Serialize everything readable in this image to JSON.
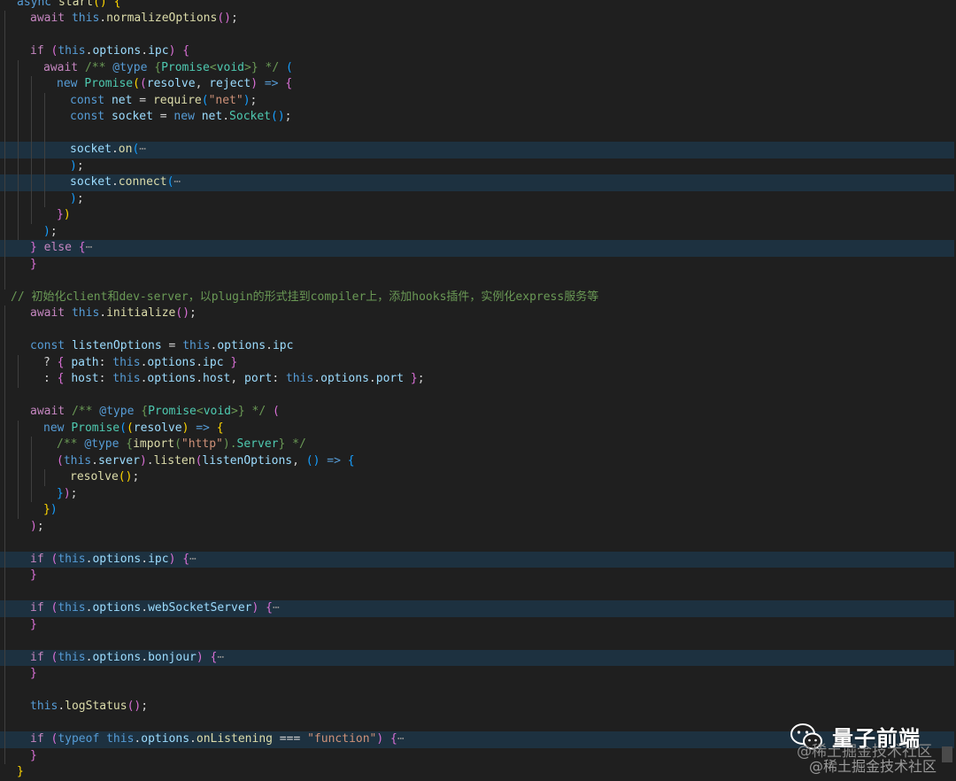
{
  "editor": {
    "lines": [
      {
        "indent": 0,
        "hl": "",
        "tokens": [
          [
            "kw",
            "async "
          ],
          [
            "fn",
            "start"
          ],
          [
            "b1",
            "()"
          ],
          [
            "pun",
            " "
          ],
          [
            "b1",
            "{"
          ]
        ]
      },
      {
        "indent": 1,
        "hl": "",
        "tokens": [
          [
            "ctl",
            "await "
          ],
          [
            "this",
            "this"
          ],
          [
            "pun",
            "."
          ],
          [
            "fn",
            "normalizeOptions"
          ],
          [
            "b2",
            "()"
          ],
          [
            "pun",
            ";"
          ]
        ]
      },
      {
        "indent": 1,
        "hl": "",
        "tokens": []
      },
      {
        "indent": 1,
        "hl": "",
        "tokens": [
          [
            "ctl",
            "if "
          ],
          [
            "b2",
            "("
          ],
          [
            "this",
            "this"
          ],
          [
            "pun",
            "."
          ],
          [
            "prop",
            "options"
          ],
          [
            "pun",
            "."
          ],
          [
            "prop",
            "ipc"
          ],
          [
            "b2",
            ")"
          ],
          [
            "pun",
            " "
          ],
          [
            "b2",
            "{"
          ]
        ]
      },
      {
        "indent": 2,
        "hl": "",
        "tokens": [
          [
            "ctl",
            "await "
          ],
          [
            "doc",
            "/** "
          ],
          [
            "tag",
            "@type"
          ],
          [
            "doc",
            " "
          ],
          [
            "doc",
            "{"
          ],
          [
            "cls",
            "Promise"
          ],
          [
            "doc",
            "<"
          ],
          [
            "cls",
            "void"
          ],
          [
            "doc",
            ">}"
          ],
          [
            "doc",
            " */ "
          ],
          [
            "b3",
            "("
          ]
        ]
      },
      {
        "indent": 3,
        "hl": "",
        "tokens": [
          [
            "kw",
            "new "
          ],
          [
            "cls",
            "Promise"
          ],
          [
            "b1",
            "("
          ],
          [
            "b2",
            "("
          ],
          [
            "var",
            "resolve"
          ],
          [
            "pun",
            ", "
          ],
          [
            "var",
            "reject"
          ],
          [
            "b2",
            ")"
          ],
          [
            "pun",
            " "
          ],
          [
            "kw",
            "=>"
          ],
          [
            "pun",
            " "
          ],
          [
            "b2",
            "{"
          ]
        ]
      },
      {
        "indent": 4,
        "hl": "",
        "tokens": [
          [
            "kw",
            "const "
          ],
          [
            "var",
            "net"
          ],
          [
            "pun",
            " = "
          ],
          [
            "fn",
            "require"
          ],
          [
            "b3",
            "("
          ],
          [
            "str",
            "\"net\""
          ],
          [
            "b3",
            ")"
          ],
          [
            "pun",
            ";"
          ]
        ]
      },
      {
        "indent": 4,
        "hl": "",
        "tokens": [
          [
            "kw",
            "const "
          ],
          [
            "var",
            "socket"
          ],
          [
            "pun",
            " = "
          ],
          [
            "kw",
            "new "
          ],
          [
            "var",
            "net"
          ],
          [
            "pun",
            "."
          ],
          [
            "cls",
            "Socket"
          ],
          [
            "b3",
            "()"
          ],
          [
            "pun",
            ";"
          ]
        ]
      },
      {
        "indent": 4,
        "hl": "",
        "tokens": []
      },
      {
        "indent": 4,
        "hl": "hl",
        "tokens": [
          [
            "var",
            "socket"
          ],
          [
            "pun",
            "."
          ],
          [
            "fn",
            "on"
          ],
          [
            "b3",
            "("
          ],
          [
            "fold",
            "⋯"
          ]
        ]
      },
      {
        "indent": 4,
        "hl": "",
        "tokens": [
          [
            "b3",
            ")"
          ],
          [
            "pun",
            ";"
          ]
        ]
      },
      {
        "indent": 4,
        "hl": "hl",
        "tokens": [
          [
            "var",
            "socket"
          ],
          [
            "pun",
            "."
          ],
          [
            "fn",
            "connect"
          ],
          [
            "b3",
            "("
          ],
          [
            "fold",
            "⋯"
          ]
        ]
      },
      {
        "indent": 4,
        "hl": "",
        "tokens": [
          [
            "b3",
            ")"
          ],
          [
            "pun",
            ";"
          ]
        ]
      },
      {
        "indent": 3,
        "hl": "",
        "tokens": [
          [
            "b2",
            "}"
          ],
          [
            "b1",
            ")"
          ]
        ]
      },
      {
        "indent": 2,
        "hl": "",
        "tokens": [
          [
            "b3",
            ")"
          ],
          [
            "pun",
            ";"
          ]
        ]
      },
      {
        "indent": 1,
        "hl": "hl",
        "tokens": [
          [
            "b2",
            "}"
          ],
          [
            "pun",
            " "
          ],
          [
            "ctl",
            "else "
          ],
          [
            "b2",
            "{"
          ],
          [
            "fold",
            "⋯"
          ]
        ]
      },
      {
        "indent": 1,
        "hl": "",
        "tokens": [
          [
            "b2",
            "}"
          ]
        ]
      },
      {
        "indent": 1,
        "hl": "",
        "tokens": []
      },
      {
        "indent": 0,
        "hl": "",
        "tokens": [
          [
            "com",
            "// 初始化client和dev-server，以plugin的形式挂到compiler上，添加hooks插件，实例化express服务等"
          ]
        ]
      },
      {
        "indent": 1,
        "hl": "",
        "tokens": [
          [
            "ctl",
            "await "
          ],
          [
            "this",
            "this"
          ],
          [
            "pun",
            "."
          ],
          [
            "fn",
            "initialize"
          ],
          [
            "b2",
            "()"
          ],
          [
            "pun",
            ";"
          ]
        ]
      },
      {
        "indent": 1,
        "hl": "",
        "tokens": []
      },
      {
        "indent": 1,
        "hl": "",
        "tokens": [
          [
            "kw",
            "const "
          ],
          [
            "var",
            "listenOptions"
          ],
          [
            "pun",
            " = "
          ],
          [
            "this",
            "this"
          ],
          [
            "pun",
            "."
          ],
          [
            "prop",
            "options"
          ],
          [
            "pun",
            "."
          ],
          [
            "prop",
            "ipc"
          ]
        ]
      },
      {
        "indent": 2,
        "hl": "",
        "tokens": [
          [
            "pun",
            "? "
          ],
          [
            "b2",
            "{"
          ],
          [
            "pun",
            " "
          ],
          [
            "prop",
            "path"
          ],
          [
            "pun",
            ": "
          ],
          [
            "this",
            "this"
          ],
          [
            "pun",
            "."
          ],
          [
            "prop",
            "options"
          ],
          [
            "pun",
            "."
          ],
          [
            "prop",
            "ipc"
          ],
          [
            "pun",
            " "
          ],
          [
            "b2",
            "}"
          ]
        ]
      },
      {
        "indent": 2,
        "hl": "",
        "tokens": [
          [
            "pun",
            ": "
          ],
          [
            "b2",
            "{"
          ],
          [
            "pun",
            " "
          ],
          [
            "prop",
            "host"
          ],
          [
            "pun",
            ": "
          ],
          [
            "this",
            "this"
          ],
          [
            "pun",
            "."
          ],
          [
            "prop",
            "options"
          ],
          [
            "pun",
            "."
          ],
          [
            "prop",
            "host"
          ],
          [
            "pun",
            ", "
          ],
          [
            "prop",
            "port"
          ],
          [
            "pun",
            ": "
          ],
          [
            "this",
            "this"
          ],
          [
            "pun",
            "."
          ],
          [
            "prop",
            "options"
          ],
          [
            "pun",
            "."
          ],
          [
            "prop",
            "port"
          ],
          [
            "pun",
            " "
          ],
          [
            "b2",
            "}"
          ],
          [
            "pun",
            ";"
          ]
        ]
      },
      {
        "indent": 1,
        "hl": "",
        "tokens": []
      },
      {
        "indent": 1,
        "hl": "",
        "tokens": [
          [
            "ctl",
            "await "
          ],
          [
            "doc",
            "/** "
          ],
          [
            "tag",
            "@type"
          ],
          [
            "doc",
            " {"
          ],
          [
            "cls",
            "Promise"
          ],
          [
            "doc",
            "<"
          ],
          [
            "cls",
            "void"
          ],
          [
            "doc",
            ">}"
          ],
          [
            "doc",
            " */ "
          ],
          [
            "b2",
            "("
          ]
        ]
      },
      {
        "indent": 2,
        "hl": "",
        "tokens": [
          [
            "kw",
            "new "
          ],
          [
            "cls",
            "Promise"
          ],
          [
            "b3",
            "("
          ],
          [
            "b1",
            "("
          ],
          [
            "var",
            "resolve"
          ],
          [
            "b1",
            ")"
          ],
          [
            "pun",
            " "
          ],
          [
            "kw",
            "=>"
          ],
          [
            "pun",
            " "
          ],
          [
            "b1",
            "{"
          ]
        ]
      },
      {
        "indent": 3,
        "hl": "",
        "tokens": [
          [
            "doc",
            "/** "
          ],
          [
            "tag",
            "@type"
          ],
          [
            "doc",
            " {"
          ],
          [
            "fn",
            "import"
          ],
          [
            "doc",
            "("
          ],
          [
            "str",
            "\"http\""
          ],
          [
            "doc",
            ")."
          ],
          [
            "cls",
            "Server"
          ],
          [
            "doc",
            "}"
          ],
          [
            "doc",
            " */"
          ]
        ]
      },
      {
        "indent": 3,
        "hl": "",
        "tokens": [
          [
            "b2",
            "("
          ],
          [
            "this",
            "this"
          ],
          [
            "pun",
            "."
          ],
          [
            "prop",
            "server"
          ],
          [
            "b2",
            ")"
          ],
          [
            "pun",
            "."
          ],
          [
            "fn",
            "listen"
          ],
          [
            "b2",
            "("
          ],
          [
            "var",
            "listenOptions"
          ],
          [
            "pun",
            ", "
          ],
          [
            "b3",
            "()"
          ],
          [
            "pun",
            " "
          ],
          [
            "kw",
            "=>"
          ],
          [
            "pun",
            " "
          ],
          [
            "b3",
            "{"
          ]
        ]
      },
      {
        "indent": 4,
        "hl": "",
        "tokens": [
          [
            "fn",
            "resolve"
          ],
          [
            "b1",
            "()"
          ],
          [
            "pun",
            ";"
          ]
        ]
      },
      {
        "indent": 3,
        "hl": "",
        "tokens": [
          [
            "b3",
            "}"
          ],
          [
            "b2",
            ")"
          ],
          [
            "pun",
            ";"
          ]
        ]
      },
      {
        "indent": 2,
        "hl": "",
        "tokens": [
          [
            "b1",
            "}"
          ],
          [
            "b3",
            ")"
          ]
        ]
      },
      {
        "indent": 1,
        "hl": "",
        "tokens": [
          [
            "b2",
            ")"
          ],
          [
            "pun",
            ";"
          ]
        ]
      },
      {
        "indent": 1,
        "hl": "",
        "tokens": []
      },
      {
        "indent": 1,
        "hl": "hl",
        "tokens": [
          [
            "ctl",
            "if "
          ],
          [
            "b2",
            "("
          ],
          [
            "this",
            "this"
          ],
          [
            "pun",
            "."
          ],
          [
            "prop",
            "options"
          ],
          [
            "pun",
            "."
          ],
          [
            "prop",
            "ipc"
          ],
          [
            "b2",
            ")"
          ],
          [
            "pun",
            " "
          ],
          [
            "b2",
            "{"
          ],
          [
            "fold",
            "⋯"
          ]
        ]
      },
      {
        "indent": 1,
        "hl": "",
        "tokens": [
          [
            "b2",
            "}"
          ]
        ]
      },
      {
        "indent": 1,
        "hl": "",
        "tokens": []
      },
      {
        "indent": 1,
        "hl": "hl",
        "tokens": [
          [
            "ctl",
            "if "
          ],
          [
            "b2",
            "("
          ],
          [
            "this",
            "this"
          ],
          [
            "pun",
            "."
          ],
          [
            "prop",
            "options"
          ],
          [
            "pun",
            "."
          ],
          [
            "prop",
            "webSocketServer"
          ],
          [
            "b2",
            ")"
          ],
          [
            "pun",
            " "
          ],
          [
            "b2",
            "{"
          ],
          [
            "fold",
            "⋯"
          ]
        ]
      },
      {
        "indent": 1,
        "hl": "",
        "tokens": [
          [
            "b2",
            "}"
          ]
        ]
      },
      {
        "indent": 1,
        "hl": "",
        "tokens": []
      },
      {
        "indent": 1,
        "hl": "hl",
        "tokens": [
          [
            "ctl",
            "if "
          ],
          [
            "b2",
            "("
          ],
          [
            "this",
            "this"
          ],
          [
            "pun",
            "."
          ],
          [
            "prop",
            "options"
          ],
          [
            "pun",
            "."
          ],
          [
            "prop",
            "bonjour"
          ],
          [
            "b2",
            ")"
          ],
          [
            "pun",
            " "
          ],
          [
            "b2",
            "{"
          ],
          [
            "fold",
            "⋯"
          ]
        ]
      },
      {
        "indent": 1,
        "hl": "",
        "tokens": [
          [
            "b2",
            "}"
          ]
        ]
      },
      {
        "indent": 1,
        "hl": "",
        "tokens": []
      },
      {
        "indent": 1,
        "hl": "",
        "tokens": [
          [
            "this",
            "this"
          ],
          [
            "pun",
            "."
          ],
          [
            "fn",
            "logStatus"
          ],
          [
            "b2",
            "()"
          ],
          [
            "pun",
            ";"
          ]
        ]
      },
      {
        "indent": 1,
        "hl": "",
        "tokens": []
      },
      {
        "indent": 1,
        "hl": "hl",
        "tokens": [
          [
            "ctl",
            "if "
          ],
          [
            "b2",
            "("
          ],
          [
            "kw",
            "typeof "
          ],
          [
            "this",
            "this"
          ],
          [
            "pun",
            "."
          ],
          [
            "prop",
            "options"
          ],
          [
            "pun",
            "."
          ],
          [
            "fn",
            "onListening"
          ],
          [
            "pun",
            " === "
          ],
          [
            "str",
            "\"function\""
          ],
          [
            "b2",
            ")"
          ],
          [
            "pun",
            " "
          ],
          [
            "b2",
            "{"
          ],
          [
            "fold",
            "⋯"
          ]
        ]
      },
      {
        "indent": 1,
        "hl": "",
        "tokens": [
          [
            "b2",
            "}"
          ]
        ]
      },
      {
        "indent": 0,
        "hl": "",
        "tokens": [
          [
            "b1",
            "}"
          ]
        ]
      }
    ]
  },
  "watermark": {
    "brand": "量子前端",
    "sub_overlap": "@稀土掘金技术社区",
    "sub": "@稀土掘金技术社区",
    "icon": "wechat-icon"
  }
}
